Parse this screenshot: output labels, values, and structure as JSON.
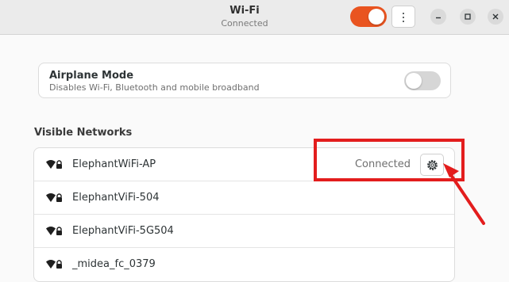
{
  "window": {
    "title": "Wi-Fi",
    "subtitle": "Connected",
    "wifi_enabled": true
  },
  "airplane_mode": {
    "title": "Airplane Mode",
    "description": "Disables Wi-Fi, Bluetooth and mobile broadband",
    "enabled": false
  },
  "networks": {
    "section_title": "Visible Networks",
    "items": [
      {
        "name": "ElephantWiFi-AP",
        "status": "Connected",
        "icon": "wifi-secured-icon"
      },
      {
        "name": "ElephantViFi-504",
        "status": "",
        "icon": "wifi-secured-icon"
      },
      {
        "name": "ElephantViFi-5G504",
        "status": "",
        "icon": "wifi-secured-icon"
      },
      {
        "name": "_midea_fc_0379",
        "status": "",
        "icon": "wifi-secured-icon"
      }
    ]
  },
  "annotation": {
    "color": "#e31d1d"
  },
  "colors": {
    "accent": "#e95420"
  }
}
